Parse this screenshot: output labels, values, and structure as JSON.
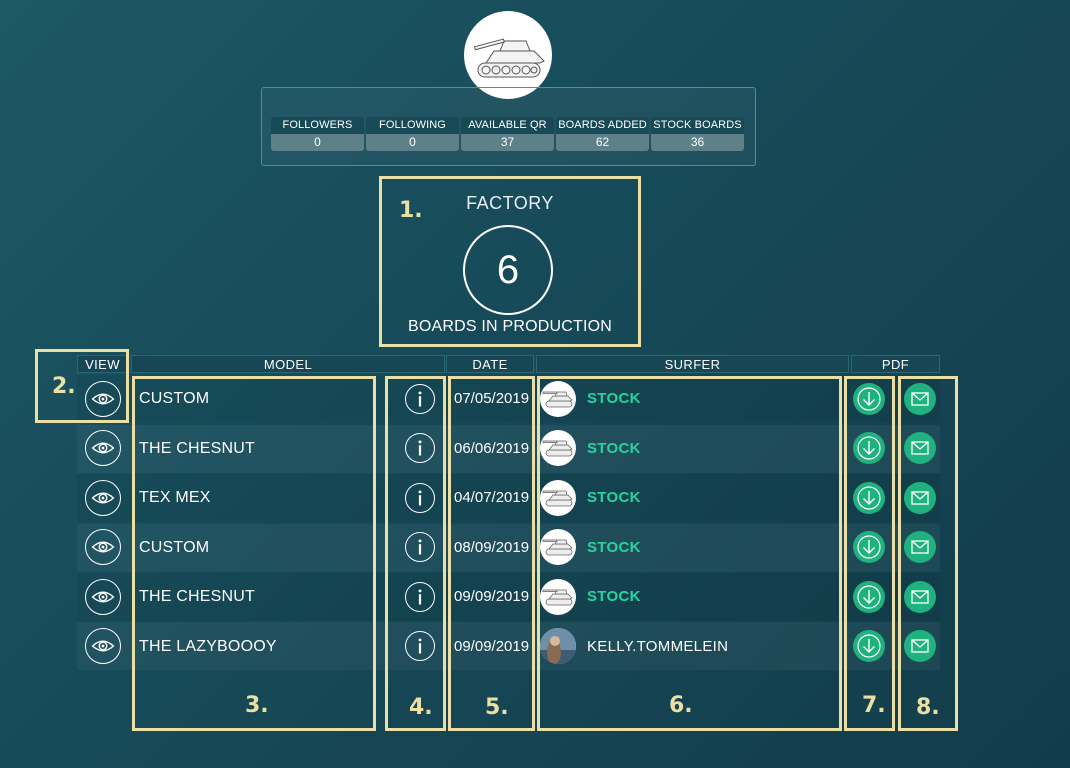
{
  "stats": [
    {
      "label": "FOLLOWERS",
      "value": "0"
    },
    {
      "label": "FOLLOWING",
      "value": "0"
    },
    {
      "label": "AVAILABLE QR",
      "value": "37"
    },
    {
      "label": "BOARDS ADDED",
      "value": "62"
    },
    {
      "label": "STOCK BOARDS",
      "value": "36"
    }
  ],
  "factory": {
    "title": "FACTORY",
    "count": "6",
    "subtitle": "BOARDS IN PRODUCTION"
  },
  "table": {
    "headers": {
      "view": "VIEW",
      "model": "MODEL",
      "date": "DATE",
      "surfer": "SURFER",
      "pdf": "PDF"
    },
    "rows": [
      {
        "model": "CUSTOM",
        "date": "07/05/2019",
        "surfer": "STOCK",
        "avatar": "tank-icon"
      },
      {
        "model": "THE CHESNUT",
        "date": "06/06/2019",
        "surfer": "STOCK",
        "avatar": "tank-icon"
      },
      {
        "model": "TEX MEX",
        "date": "04/07/2019",
        "surfer": "STOCK",
        "avatar": "tank-icon"
      },
      {
        "model": "CUSTOM",
        "date": "08/09/2019",
        "surfer": "STOCK",
        "avatar": "tank-icon"
      },
      {
        "model": "THE CHESNUT",
        "date": "09/09/2019",
        "surfer": "STOCK",
        "avatar": "tank-icon"
      },
      {
        "model": "THE LAZYBOOOY",
        "date": "09/09/2019",
        "surfer": "KELLY.TOMMELEIN",
        "avatar": "user-photo"
      }
    ]
  },
  "annotations": [
    "1.",
    "2.",
    "3.",
    "4.",
    "5.",
    "6.",
    "7.",
    "8."
  ],
  "colors": {
    "background": "#174a58",
    "accent_green": "#1fb17e",
    "stock_text": "#28d49c",
    "annotation_yellow": "#ecdfa6"
  },
  "icons": {
    "profile_avatar": "tank-icon",
    "view": "eye-icon",
    "info": "info-icon",
    "pdf": "download-arrow-icon",
    "email": "envelope-icon"
  }
}
